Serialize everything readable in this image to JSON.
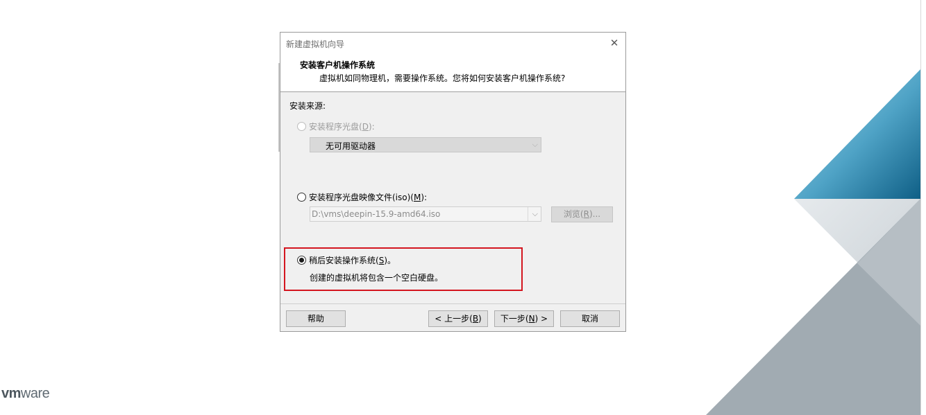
{
  "desktop": {
    "logo_text": "vmware"
  },
  "dialog": {
    "title": "新建虚拟机向导",
    "close_glyph": "✕",
    "header": {
      "title": "安装客户机操作系统",
      "subtitle": "虚拟机如同物理机，需要操作系统。您将如何安装客户机操作系统?"
    },
    "install_source_label": "安装来源:",
    "options": {
      "disc": {
        "label_prefix": "安装程序光盘(",
        "mnemonic": "D",
        "label_suffix": "):",
        "selected": false,
        "enabled": false,
        "drive_value": "无可用驱动器"
      },
      "iso": {
        "label_prefix": "安装程序光盘映像文件(iso)(",
        "mnemonic": "M",
        "label_suffix": "):",
        "selected": false,
        "enabled": true,
        "path_value": "D:\\vms\\deepin-15.9-amd64.iso",
        "browse_prefix": "浏览(",
        "browse_mnemonic": "R",
        "browse_suffix": ")..."
      },
      "later": {
        "label_prefix": "稍后安装操作系统(",
        "mnemonic": "S",
        "label_suffix": ")。",
        "selected": true,
        "enabled": true,
        "description": "创建的虚拟机将包含一个空白硬盘。"
      }
    },
    "buttons": {
      "help": "帮助",
      "back_prefix": "< 上一步(",
      "back_mnemonic": "B",
      "back_suffix": ")",
      "next_prefix": "下一步(",
      "next_mnemonic": "N",
      "next_suffix": ") >",
      "cancel": "取消"
    }
  },
  "colors": {
    "highlight_border": "#d4151f",
    "vmware_blue_light": "#8cc9e0",
    "vmware_blue_dark": "#1f6f93",
    "vmware_gray": "#9aa5ad"
  }
}
